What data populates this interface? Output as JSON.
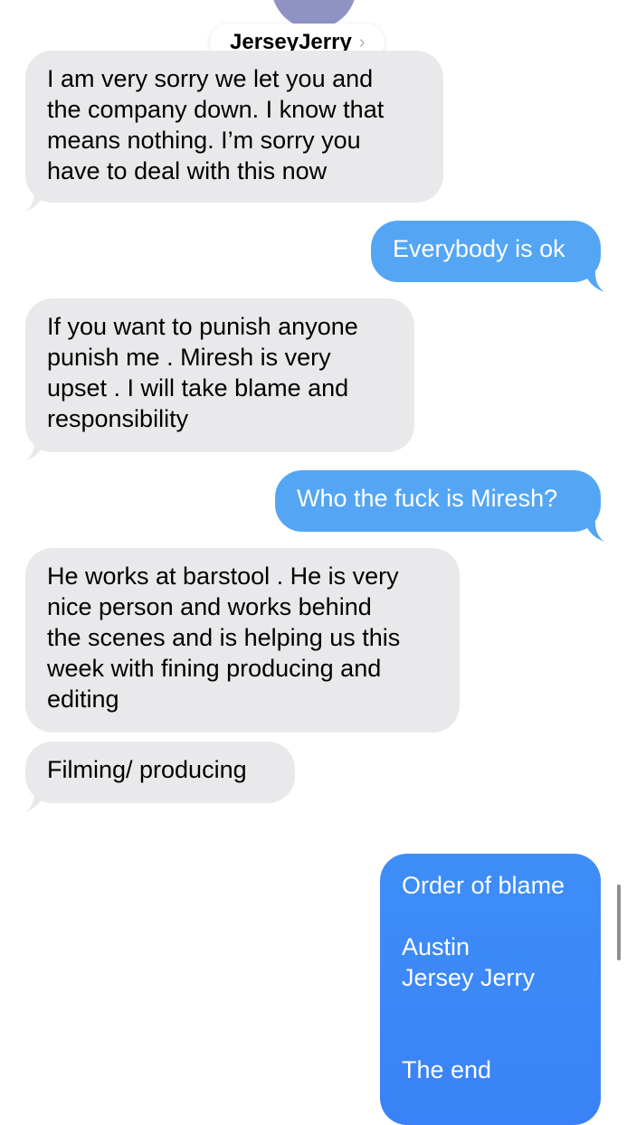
{
  "header": {
    "contact_name": "JerseyJerry",
    "chevron": "›"
  },
  "messages": [
    {
      "direction": "incoming",
      "text": "I am very sorry we let you and\nthe company down. I know that\nmeans nothing. I’m sorry you\nhave to deal with this now"
    },
    {
      "direction": "outgoing",
      "text": "Everybody is ok"
    },
    {
      "direction": "incoming",
      "text": "If you want to punish anyone\npunish me . Miresh is very\nupset . I will take blame and\nresponsibility"
    },
    {
      "direction": "outgoing",
      "text": "Who the fuck is Miresh?"
    },
    {
      "direction": "incoming",
      "text": "He works at barstool . He is very\nnice person and works behind\nthe scenes and is helping us this\nweek with fining producing and\nediting"
    },
    {
      "direction": "incoming",
      "text": "Filming/ producing"
    },
    {
      "direction": "outgoing",
      "text": "Order of blame\n\nAustin\nJersey Jerry\n\n\nThe end"
    }
  ],
  "icons": {
    "avatar": "contact-avatar",
    "chevron": "chevron-right-icon"
  },
  "colors": {
    "incoming_bubble": "#e9e9eb",
    "outgoing_bubble": "#54a6f5",
    "outgoing_bubble_dark": "#3a82f7"
  }
}
